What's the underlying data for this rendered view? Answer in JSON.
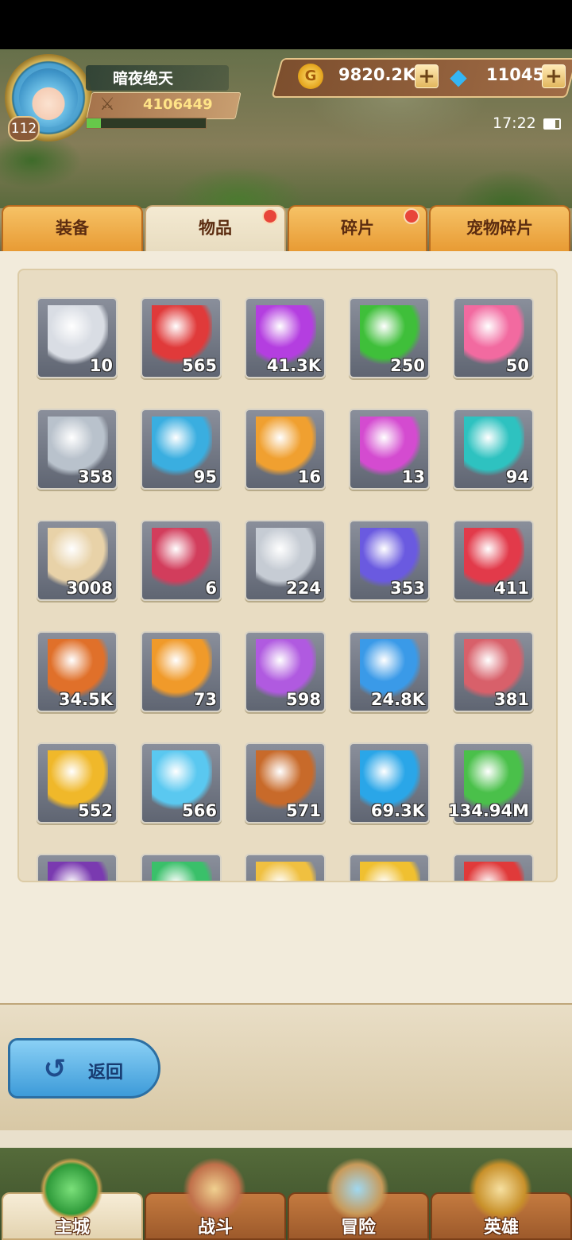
{
  "player": {
    "name": "暗夜绝天",
    "level": "112",
    "power": "4106449",
    "exp_fraction": 0.12
  },
  "resources": {
    "gold": "9820.2K",
    "diamond": "11045",
    "gold_icon": "coin-icon",
    "diamond_icon": "diamond-icon"
  },
  "status": {
    "time": "17:22"
  },
  "tabs": [
    {
      "label": "装备",
      "badge": false
    },
    {
      "label": "物品",
      "badge": true,
      "active": true
    },
    {
      "label": "碎片",
      "badge": true
    },
    {
      "label": "宠物碎片",
      "badge": false
    }
  ],
  "items": [
    {
      "icon": "armor-pieces",
      "qty": "10",
      "color": "#d9dde4"
    },
    {
      "icon": "red-sword-gem",
      "qty": "565",
      "color": "#e03a3a"
    },
    {
      "icon": "purple-potion",
      "qty": "41.3K",
      "color": "#b43ee0"
    },
    {
      "icon": "four-leaf-clover",
      "qty": "250",
      "color": "#3fbf3a"
    },
    {
      "icon": "pink-lollipop",
      "qty": "50",
      "color": "#f26aa0"
    },
    {
      "icon": "silver-key",
      "qty": "358",
      "color": "#b9c2cc"
    },
    {
      "icon": "blue-egg",
      "qty": "95",
      "color": "#3aaee0"
    },
    {
      "icon": "rainbow-lollipop",
      "qty": "16",
      "color": "#f0a030"
    },
    {
      "icon": "pink-crystal",
      "qty": "13",
      "color": "#d44bd0"
    },
    {
      "icon": "teal-bottle",
      "qty": "94",
      "color": "#2ec2c0"
    },
    {
      "icon": "bone",
      "qty": "3008",
      "color": "#e8d2a8"
    },
    {
      "icon": "red-rune-stone",
      "qty": "6",
      "color": "#d23d5c"
    },
    {
      "icon": "silver-coin",
      "qty": "224",
      "color": "#c6ccd4"
    },
    {
      "icon": "purple-boot-gem",
      "qty": "353",
      "color": "#6a5ae0"
    },
    {
      "icon": "red-star-shard",
      "qty": "411",
      "color": "#e23a4a"
    },
    {
      "icon": "orange-rune-rock",
      "qty": "34.5K",
      "color": "#e0702a"
    },
    {
      "icon": "orange-potion",
      "qty": "73",
      "color": "#f09a2a"
    },
    {
      "icon": "purple-helmet-gem",
      "qty": "598",
      "color": "#b05ae0"
    },
    {
      "icon": "blue-crystals",
      "qty": "24.8K",
      "color": "#3a9ae8"
    },
    {
      "icon": "meat-steak",
      "qty": "381",
      "color": "#d8606a"
    },
    {
      "icon": "gold-armor-gem",
      "qty": "552",
      "color": "#f0b82a"
    },
    {
      "icon": "blue-shield-gem",
      "qty": "566",
      "color": "#5ac8f0"
    },
    {
      "icon": "bronze-coin",
      "qty": "571",
      "color": "#c86a2a"
    },
    {
      "icon": "blue-orb",
      "qty": "69.3K",
      "color": "#2aa6e8"
    },
    {
      "icon": "green-potion",
      "qty": "134.94M",
      "color": "#4ac04a"
    },
    {
      "icon": "witch-hat",
      "qty": "",
      "color": "#7a3ab0"
    },
    {
      "icon": "green-gem",
      "qty": "",
      "color": "#3ac06a"
    },
    {
      "icon": "yellow-gem",
      "qty": "",
      "color": "#f0c040"
    },
    {
      "icon": "gold-bar",
      "qty": "",
      "color": "#f0c030"
    },
    {
      "icon": "red-heart",
      "qty": "",
      "color": "#e03a3a"
    }
  ],
  "back_button": {
    "label": "返回"
  },
  "nav": [
    {
      "label": "主城",
      "icon": "castle-icon",
      "active": true
    },
    {
      "label": "战斗",
      "icon": "crossed-swords-icon"
    },
    {
      "label": "冒险",
      "icon": "adventure-icon"
    },
    {
      "label": "英雄",
      "icon": "hero-helmet-icon"
    }
  ]
}
